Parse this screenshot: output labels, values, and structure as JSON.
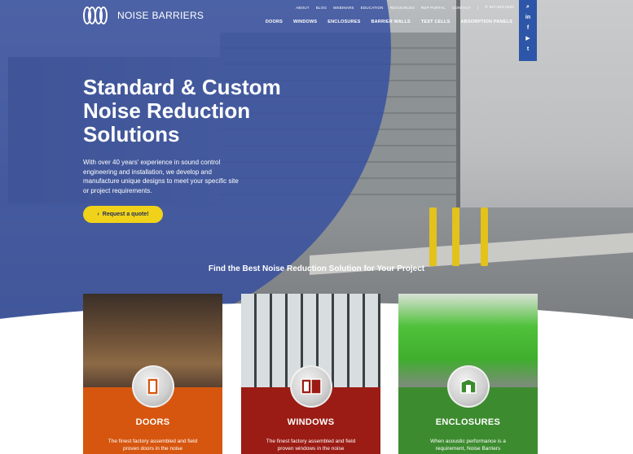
{
  "brand": {
    "name": "NOISE BARRIERS"
  },
  "utility_nav": [
    "ABOUT",
    "BLOG",
    "WEBINARS",
    "EDUCATION",
    "RESOURCES",
    "REP PORTAL",
    "CONTACT",
    "|",
    "847-843-0500"
  ],
  "main_nav": [
    "DOORS",
    "WINDOWS",
    "ENCLOSURES",
    "BARRIER WALLS",
    "TEST CELLS",
    "ABSORPTION PANELS"
  ],
  "social": [
    {
      "icon": "search-icon",
      "glyph": "⌕"
    },
    {
      "icon": "linkedin-icon",
      "glyph": "in"
    },
    {
      "icon": "facebook-icon",
      "glyph": "f"
    },
    {
      "icon": "youtube-icon",
      "glyph": "▶"
    },
    {
      "icon": "twitter-icon",
      "glyph": "t"
    }
  ],
  "hero": {
    "title": "Standard & Custom Noise Reduction Solutions",
    "subtitle": "With over 40 years' experience in sound control engineering and installation, we develop and manufacture unique designs to meet your specific site or project requirements.",
    "cta_label": "Request a quote!"
  },
  "section_heading": "Find the Best Noise Reduction Solution for Your Project",
  "cards": [
    {
      "title": "DOORS",
      "desc": "The finest factory assembled and field proven doors in the noise",
      "icon": "door-icon",
      "color": "#d6560f"
    },
    {
      "title": "WINDOWS",
      "desc": "The finest factory assembled and field proven windows in the noise",
      "icon": "window-icon",
      "color": "#9b1c14"
    },
    {
      "title": "ENCLOSURES",
      "desc": "When acoustic performance is a requirement, Noise Barriers",
      "icon": "enclosure-icon",
      "color": "#3d8b2f"
    }
  ],
  "colors": {
    "overlay_blue": "#344ea0",
    "cta_yellow": "#f1d21a",
    "social_blue": "#2d56a8"
  }
}
